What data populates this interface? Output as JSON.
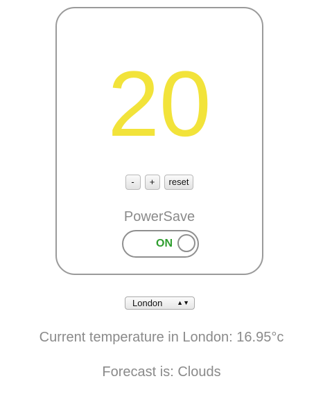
{
  "thermostat": {
    "temperature": "20",
    "temperature_color": "#f2e33a",
    "buttons": {
      "decrease_label": "-",
      "increase_label": "+",
      "reset_label": "reset"
    },
    "powersave": {
      "label": "PowerSave",
      "state": "ON",
      "state_color": "#2f9e2f"
    }
  },
  "city_select": {
    "selected": "London",
    "arrows": "▲▼"
  },
  "weather": {
    "current_temperature_text": "Current temperature in London: 16.95°c",
    "forecast_text": "Forecast is: Clouds"
  }
}
